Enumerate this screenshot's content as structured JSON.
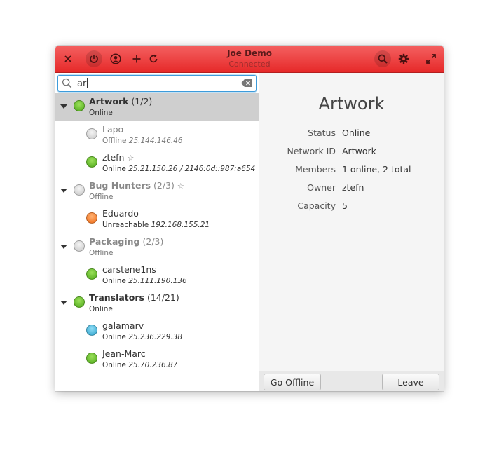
{
  "header": {
    "title": "Joe Demo",
    "subtitle": "Connected",
    "close_icon": "close-icon",
    "power_icon": "power-icon",
    "account_icon": "account-icon",
    "add_icon": "plus-icon",
    "refresh_icon": "refresh-icon",
    "search_icon": "search-icon",
    "settings_icon": "gear-icon",
    "maximize_icon": "maximize-icon",
    "accent_color": "#e62929"
  },
  "search": {
    "value": "ar"
  },
  "tree": [
    {
      "type": "group",
      "name": "Artwork",
      "count": "(1/2)",
      "status": "Online",
      "color": "green",
      "selected": true,
      "starred": false,
      "offline": false,
      "members": [
        {
          "name": "Lapo",
          "status": "Offline",
          "address": "25.144.146.46",
          "color": "grey",
          "starred": false
        },
        {
          "name": "ztefn",
          "status": "Online",
          "address": "25.21.150.26 / 2146:0d::987:a654",
          "color": "green",
          "starred": true
        }
      ]
    },
    {
      "type": "group",
      "name": "Bug Hunters",
      "count": "(2/3)",
      "status": "Offline",
      "color": "grey",
      "selected": false,
      "starred": true,
      "offline": true,
      "members": [
        {
          "name": "Eduardo",
          "status": "Unreachable",
          "address": "192.168.155.21",
          "color": "orange",
          "starred": false
        }
      ]
    },
    {
      "type": "group",
      "name": "Packaging",
      "count": "(2/3)",
      "status": "Offline",
      "color": "grey",
      "selected": false,
      "starred": false,
      "offline": true,
      "members": [
        {
          "name": "carstene1ns",
          "status": "Online",
          "address": "25.111.190.136",
          "color": "green",
          "starred": false
        }
      ]
    },
    {
      "type": "group",
      "name": "Translators",
      "count": "(14/21)",
      "status": "Online",
      "color": "green",
      "selected": false,
      "starred": false,
      "offline": false,
      "members": [
        {
          "name": "galamarv",
          "status": "Online",
          "address": "25.236.229.38",
          "color": "blue",
          "starred": false
        },
        {
          "name": "Jean-Marc",
          "status": "Online",
          "address": "25.70.236.87",
          "color": "green",
          "starred": false
        }
      ]
    }
  ],
  "details": {
    "title": "Artwork",
    "properties": [
      {
        "key": "Status",
        "value": "Online"
      },
      {
        "key": "Network ID",
        "value": "Artwork"
      },
      {
        "key": "Members",
        "value": "1 online, 2 total"
      },
      {
        "key": "Owner",
        "value": "ztefn"
      },
      {
        "key": "Capacity",
        "value": "5"
      }
    ]
  },
  "actions": {
    "go_offline_label": "Go Offline",
    "leave_label": "Leave"
  }
}
